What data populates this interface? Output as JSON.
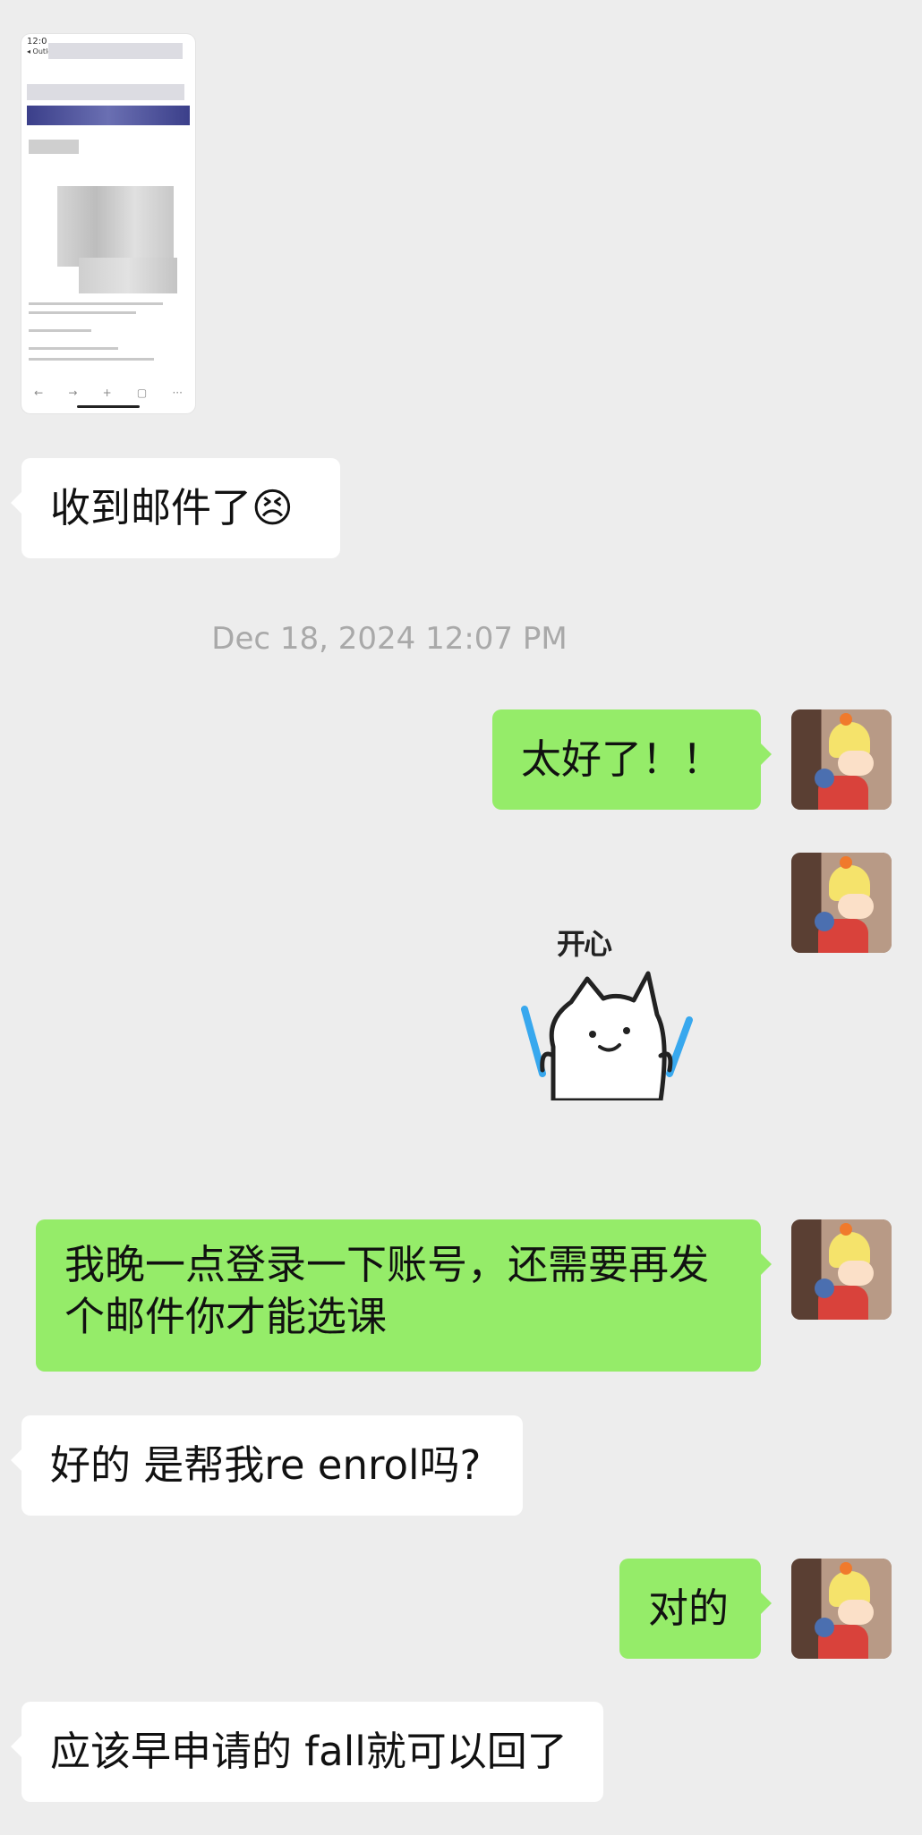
{
  "messages": {
    "m1": "收到邮件了😣",
    "timestamp": "Dec 18, 2024 12:07 PM",
    "m2": "太好了！！",
    "sticker_text": "开心",
    "m3_line1": "我晚一点登录一下账号，还需要再发",
    "m3_line2": "个邮件你才能选课",
    "m4": "好的 是帮我re enrol吗?",
    "m5": "对的",
    "m6": "应该早申请的 fall就可以回了"
  },
  "thumbnail": {
    "status_time": "12:0",
    "status_back": "◂ Outlo",
    "nav_icons": [
      "←",
      "→",
      "+",
      "▢",
      "···"
    ]
  },
  "colors": {
    "background": "#ededed",
    "incoming_bubble": "#ffffff",
    "outgoing_bubble": "#95ec69",
    "timestamp_text": "#a9a9a9"
  }
}
